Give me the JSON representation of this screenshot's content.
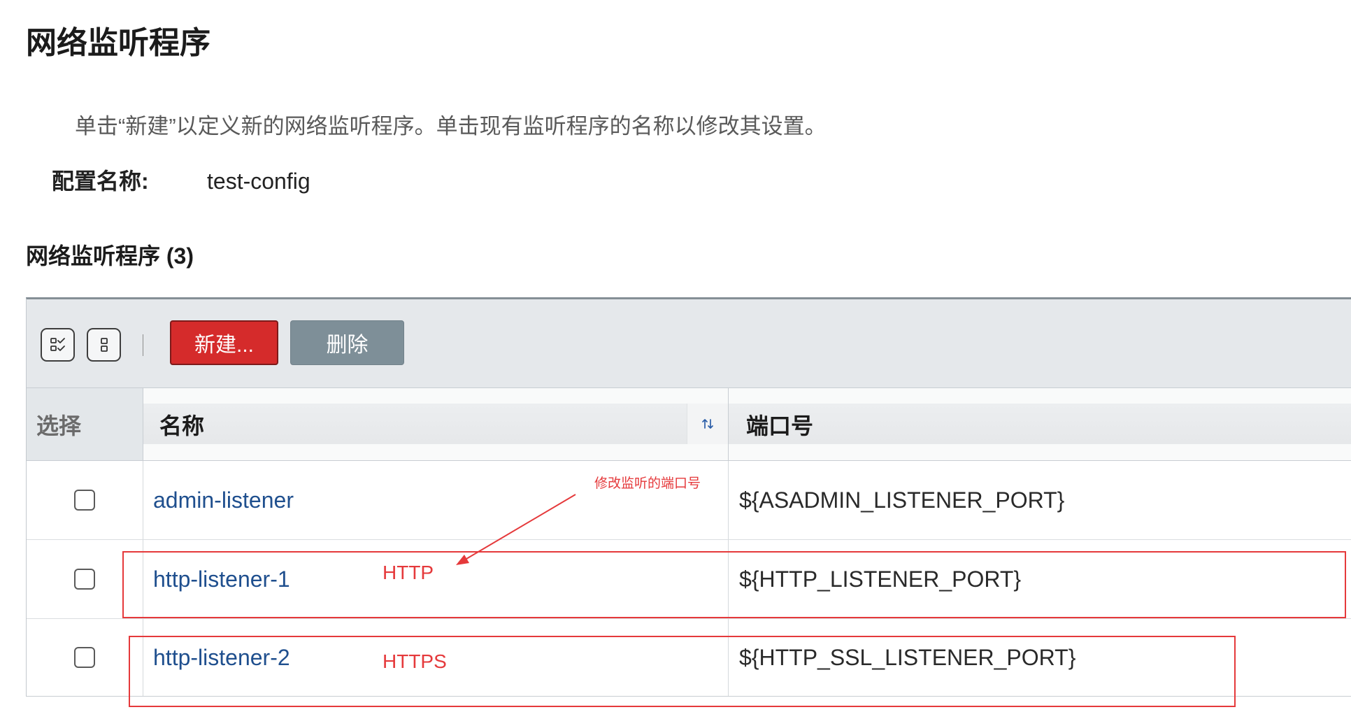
{
  "page": {
    "title": "网络监听程序",
    "description": "单击“新建”以定义新的网络监听程序。单击现有监听程序的名称以修改其设置。"
  },
  "config": {
    "label": "配置名称:",
    "value": "test-config"
  },
  "section": {
    "title": "网络监听程序 (3)"
  },
  "toolbar": {
    "select_all_icon": "select-all-icon",
    "deselect_all_icon": "deselect-all-icon",
    "new_label": "新建...",
    "delete_label": "删除"
  },
  "table": {
    "headers": {
      "select": "选择",
      "name": "名称",
      "port": "端口号"
    },
    "sort_icon": "sort-icon",
    "rows": [
      {
        "name": "admin-listener",
        "port": "${ASADMIN_LISTENER_PORT}",
        "checked": false
      },
      {
        "name": "http-listener-1",
        "port": "${HTTP_LISTENER_PORT}",
        "checked": false
      },
      {
        "name": "http-listener-2",
        "port": "${HTTP_SSL_LISTENER_PORT}",
        "checked": false
      }
    ]
  },
  "annotations": {
    "note": "修改监听的端口号",
    "http_label": "HTTP",
    "https_label": "HTTPS"
  },
  "colors": {
    "new_button": "#d52b2b",
    "delete_button": "#7e8f98",
    "link": "#1f4f8e",
    "annotation": "#e5393b"
  }
}
